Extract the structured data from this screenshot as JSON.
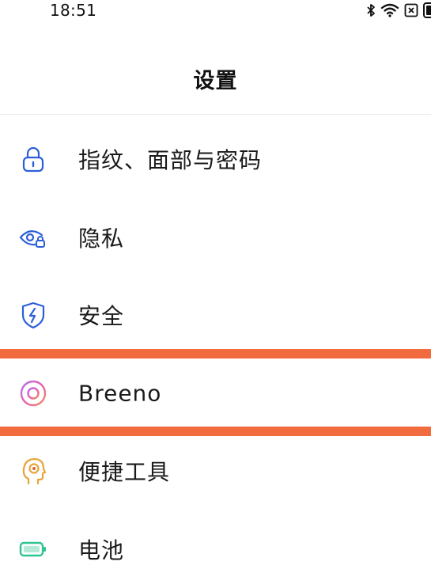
{
  "status_bar": {
    "time": "18:51",
    "icons": [
      "bluetooth-icon",
      "wifi-icon",
      "sim-icon",
      "battery-icon"
    ]
  },
  "header": {
    "title": "设置"
  },
  "settings": {
    "items": [
      {
        "label": "指纹、面部与密码",
        "icon": "lock-icon"
      },
      {
        "label": "隐私",
        "icon": "privacy-eye-icon"
      },
      {
        "label": "安全",
        "icon": "shield-bolt-icon"
      },
      {
        "label": "Breeno",
        "icon": "breeno-ring-icon"
      },
      {
        "label": "便捷工具",
        "icon": "smart-tools-head-icon"
      },
      {
        "label": "电池",
        "icon": "battery-icon"
      }
    ]
  },
  "colors": {
    "accent_blue": "#2b5fd9",
    "highlight": "#f26b3f",
    "battery_green": "#2fc48f",
    "tools_orange": "#e8a43a"
  }
}
